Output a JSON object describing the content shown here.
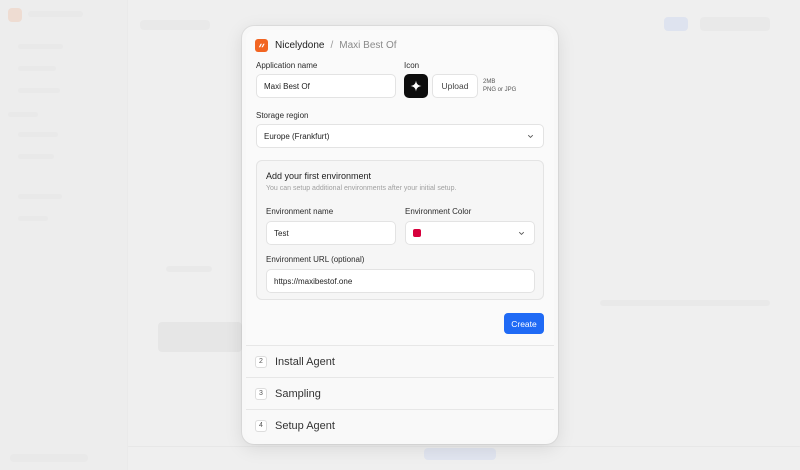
{
  "breadcrumb": {
    "app": "Nicelydone",
    "separator": "/",
    "current": "Maxi Best Of"
  },
  "form": {
    "app_name_label": "Application name",
    "app_name_value": "Maxi Best Of",
    "icon_label": "Icon",
    "upload_label": "Upload",
    "upload_hint_size": "2MB",
    "upload_hint_types": "PNG or JPG",
    "region_label": "Storage region",
    "region_value": "Europe (Frankfurt)"
  },
  "environment": {
    "title": "Add your first environment",
    "subtitle": "You can setup additional environments after your initial setup.",
    "name_label": "Environment name",
    "name_value": "Test",
    "color_label": "Environment Color",
    "color_value": "#d6003c",
    "url_label": "Environment URL (optional)",
    "url_value": "https://maxibestof.one"
  },
  "create_label": "Create",
  "steps": [
    {
      "num": "2",
      "label": "Install Agent"
    },
    {
      "num": "3",
      "label": "Sampling"
    },
    {
      "num": "4",
      "label": "Setup Agent"
    }
  ],
  "colors": {
    "accent": "#1f6af5",
    "brand": "#f26522",
    "env_color": "#d6003c"
  }
}
